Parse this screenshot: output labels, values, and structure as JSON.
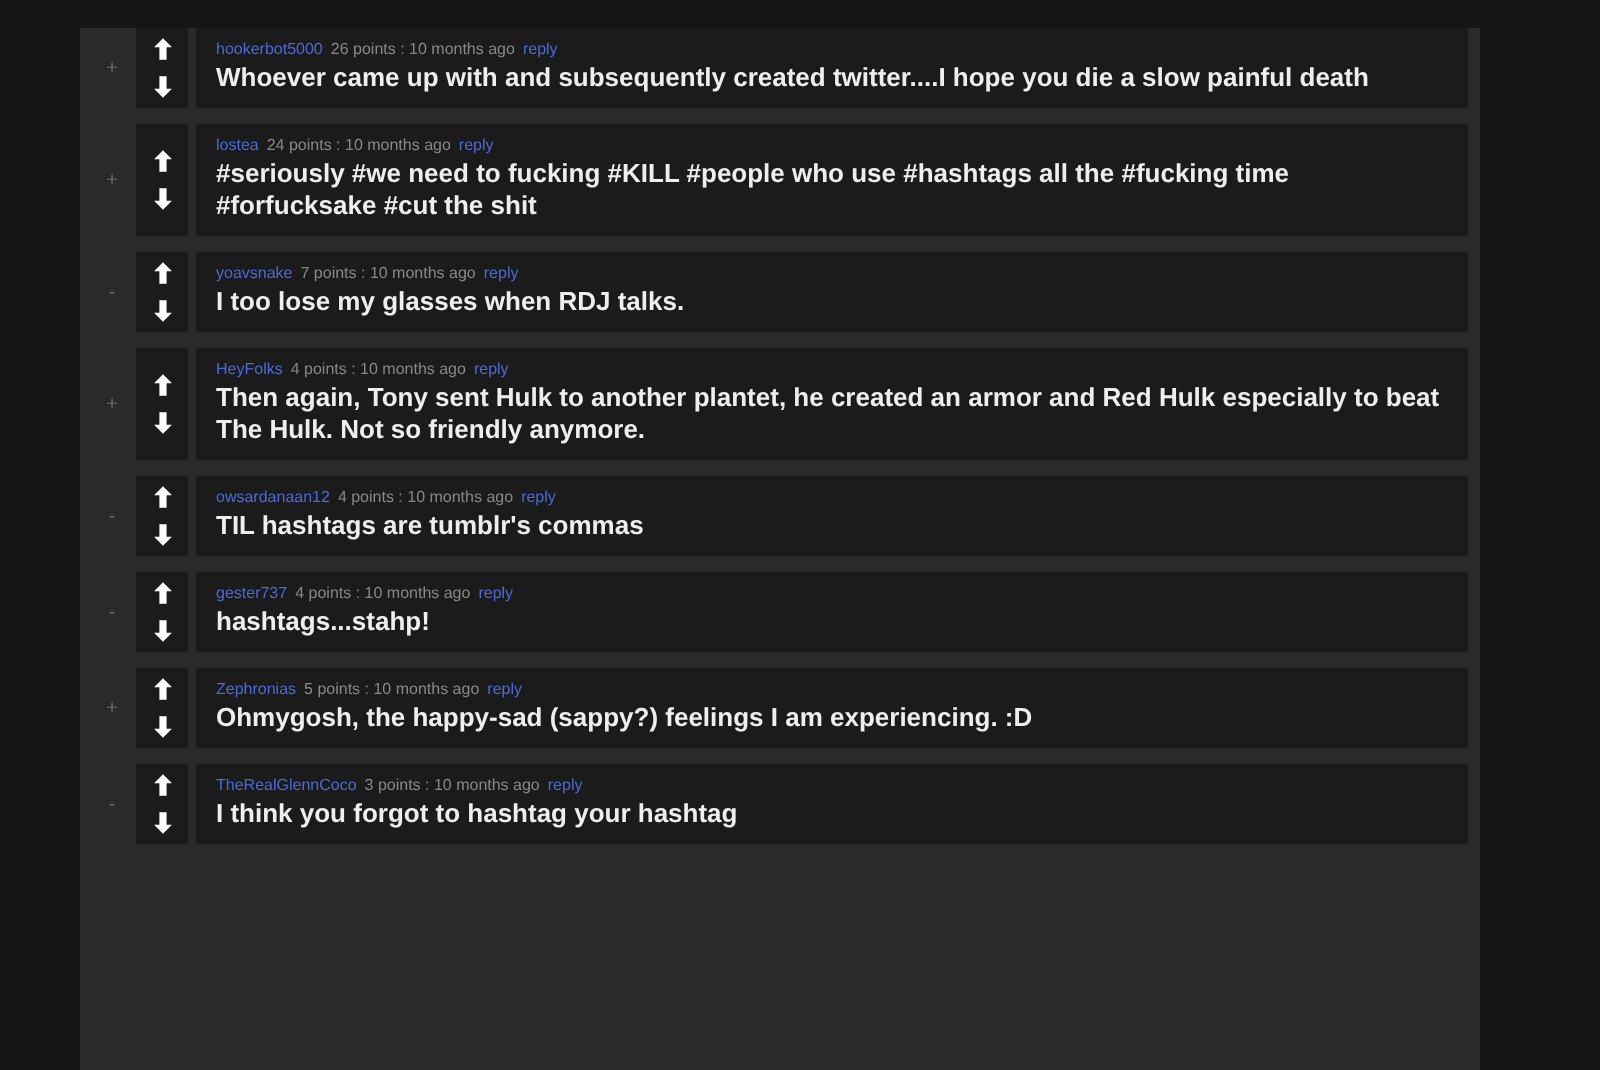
{
  "comments": [
    {
      "toggle": "+",
      "author": "hookerbot5000",
      "meta": "26 points : 10 months ago",
      "reply": "reply",
      "body": "Whoever came up with and subsequently created twitter....I hope you die a slow painful death"
    },
    {
      "toggle": "+",
      "author": "lostea",
      "meta": "24 points : 10 months ago",
      "reply": "reply",
      "body": "#seriously #we need to fucking #KILL #people who use #hashtags all the #fucking time #forfucksake #cut the shit"
    },
    {
      "toggle": "-",
      "author": "yoavsnake",
      "meta": "7 points : 10 months ago",
      "reply": "reply",
      "body": "I too lose my glasses when RDJ talks."
    },
    {
      "toggle": "+",
      "author": "HeyFolks",
      "meta": "4 points : 10 months ago",
      "reply": "reply",
      "body": "Then again, Tony sent Hulk to another plantet, he created an armor and Red Hulk especially to beat The Hulk. Not so friendly anymore."
    },
    {
      "toggle": "-",
      "author": "owsardanaan12",
      "meta": "4 points : 10 months ago",
      "reply": "reply",
      "body": "TIL hashtags are tumblr's commas"
    },
    {
      "toggle": "-",
      "author": "gester737",
      "meta": "4 points : 10 months ago",
      "reply": "reply",
      "body": "hashtags...stahp!"
    },
    {
      "toggle": "+",
      "author": "Zephronias",
      "meta": "5 points : 10 months ago",
      "reply": "reply",
      "body": "Ohmygosh, the happy-sad (sappy?) feelings I am experiencing. :D"
    },
    {
      "toggle": "-",
      "author": "TheRealGlennCoco",
      "meta": "3 points : 10 months ago",
      "reply": "reply",
      "body": "I think you forgot to hashtag your hashtag"
    }
  ]
}
